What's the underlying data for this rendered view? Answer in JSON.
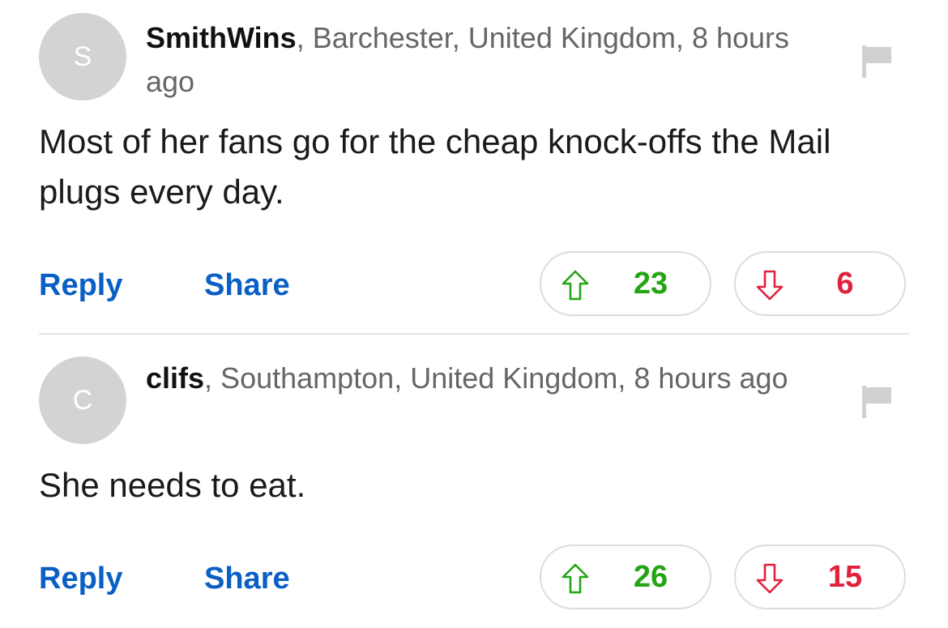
{
  "colors": {
    "link": "#0a5fc4",
    "upvote": "#23a514",
    "downvote": "#e0213d",
    "avatar_bg": "#d3d3d3",
    "meta_text": "#666666"
  },
  "comments": [
    {
      "avatar_letter": "S",
      "username": "SmithWins",
      "location_time": ", Barchester, United Kingdom, 8 hours ago",
      "text": "Most of her fans go for the cheap knock-offs the Mail plugs every day.",
      "reply_label": "Reply",
      "share_label": "Share",
      "upvotes": "23",
      "downvotes": "6",
      "flag_icon": "flag-icon",
      "upvote_icon": "arrow-up-icon",
      "downvote_icon": "arrow-down-icon"
    },
    {
      "avatar_letter": "C",
      "username": "clifs",
      "location_time": ", Southampton, United Kingdom, 8 hours ago",
      "text": "She needs to eat.",
      "reply_label": "Reply",
      "share_label": "Share",
      "upvotes": "26",
      "downvotes": "15",
      "flag_icon": "flag-icon",
      "upvote_icon": "arrow-up-icon",
      "downvote_icon": "arrow-down-icon"
    }
  ]
}
